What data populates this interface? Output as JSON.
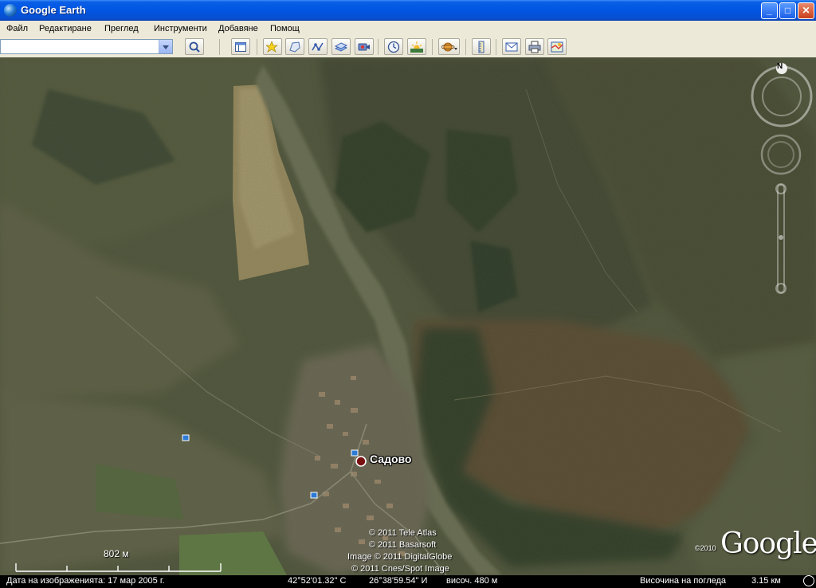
{
  "window": {
    "title": "Google Earth"
  },
  "menu": [
    "Файл",
    "Редактиране",
    "Преглед",
    "Инструменти",
    "Добавяне",
    "Помощ"
  ],
  "toolbar": {
    "search_value": "",
    "icons": [
      "sidebar-toggle-icon",
      "placemark-icon",
      "polygon-icon",
      "path-icon",
      "image-overlay-icon",
      "record-tour-icon",
      "historical-imagery-icon",
      "sunlight-icon",
      "planet-icon",
      "ruler-icon",
      "email-icon",
      "print-icon",
      "view-in-maps-icon"
    ]
  },
  "map": {
    "place_label": "Садово",
    "compass_letter": "N",
    "scale_label": "802 м",
    "copyrights": [
      "© 2011 Tele Atlas",
      "© 2011 Basarsoft",
      "Image © 2011 DigitalGlobe",
      "© 2011 Cnes/Spot Image"
    ],
    "logo_text": "Google",
    "logo_year": "©2010"
  },
  "status": {
    "imagery_date": "Дата на изображенията: 17 мар 2005 г.",
    "lat": "42°52'01.32\" С",
    "lon": "26°38'59.54\" И",
    "elev": "височ.  480 м",
    "eye_alt": "Височина на погледа",
    "eye_alt_value": "3.15 км"
  },
  "colors": {
    "titlebar": "#0056e2",
    "chrome": "#ece9d8",
    "map_base": "#4d523c"
  }
}
